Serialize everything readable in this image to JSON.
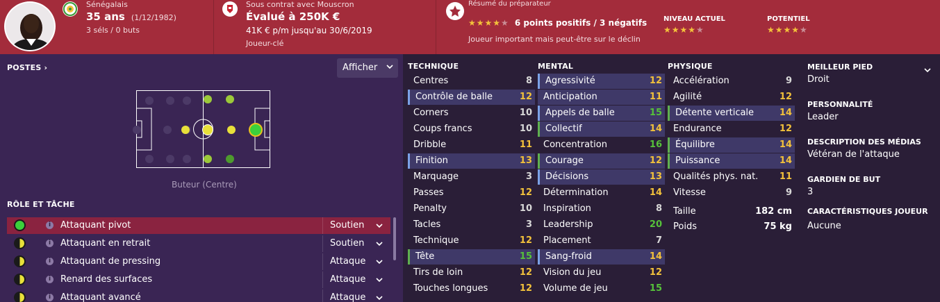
{
  "header": {
    "nationality": "Sénégalais",
    "age": "35 ans",
    "dob": "(1/12/1982)",
    "caps": "3 séls / 0 buts",
    "contract_label": "Sous contrat avec Mouscron",
    "value": "Évalué à 250K €",
    "wage": "41K € p/m jusqu'au 30/6/2019",
    "status": "Joueur-clé",
    "summary_label": "Résumé du préparateur",
    "summary_points": "6 points positifs / 3 négatifs",
    "summary_stars": "★★★★",
    "summary_empty": "★",
    "summary_text": "Joueur important mais peut-être sur le déclin",
    "level_label": "NIVEAU ACTUEL",
    "level_stars": "★★★★",
    "level_empty": "★",
    "potential_label": "POTENTIEL",
    "potential_stars": "★★★★",
    "potential_empty": "★"
  },
  "positions": {
    "title": "POSTES",
    "title_arrow": "›",
    "show_button": "Afficher",
    "caption": "Buteur (Centre)"
  },
  "roles": {
    "title": "RÔLE ET TÂCHE",
    "items": [
      {
        "name": "Attaquant pivot",
        "duty": "Soutien",
        "icon": "full-green"
      },
      {
        "name": "Attaquant en retrait",
        "duty": "Soutien",
        "icon": "half-yellow"
      },
      {
        "name": "Attaquant de pressing",
        "duty": "Attaque",
        "icon": "half-yellow"
      },
      {
        "name": "Renard des surfaces",
        "duty": "Attaque",
        "icon": "half-yellow"
      },
      {
        "name": "Attaquant avancé",
        "duty": "Attaque",
        "icon": "half-yellow"
      }
    ]
  },
  "technique": {
    "title": "TECHNIQUE",
    "items": [
      {
        "label": "Centres",
        "value": "8"
      },
      {
        "label": "Contrôle de balle",
        "value": "12"
      },
      {
        "label": "Corners",
        "value": "10"
      },
      {
        "label": "Coups francs",
        "value": "10"
      },
      {
        "label": "Dribble",
        "value": "11"
      },
      {
        "label": "Finition",
        "value": "13"
      },
      {
        "label": "Marquage",
        "value": "3"
      },
      {
        "label": "Passes",
        "value": "12"
      },
      {
        "label": "Penalty",
        "value": "10"
      },
      {
        "label": "Tacles",
        "value": "3"
      },
      {
        "label": "Technique",
        "value": "12"
      },
      {
        "label": "Tête",
        "value": "15"
      },
      {
        "label": "Tirs de loin",
        "value": "12"
      },
      {
        "label": "Touches longues",
        "value": "12"
      }
    ]
  },
  "mental": {
    "title": "MENTAL",
    "items": [
      {
        "label": "Agressivité",
        "value": "12"
      },
      {
        "label": "Anticipation",
        "value": "11"
      },
      {
        "label": "Appels de balle",
        "value": "15"
      },
      {
        "label": "Collectif",
        "value": "14"
      },
      {
        "label": "Concentration",
        "value": "16"
      },
      {
        "label": "Courage",
        "value": "12"
      },
      {
        "label": "Décisions",
        "value": "13"
      },
      {
        "label": "Détermination",
        "value": "14"
      },
      {
        "label": "Inspiration",
        "value": "8"
      },
      {
        "label": "Leadership",
        "value": "20"
      },
      {
        "label": "Placement",
        "value": "7"
      },
      {
        "label": "Sang-froid",
        "value": "14"
      },
      {
        "label": "Vision du jeu",
        "value": "12"
      },
      {
        "label": "Volume de jeu",
        "value": "15"
      }
    ]
  },
  "physique": {
    "title": "PHYSIQUE",
    "items": [
      {
        "label": "Accélération",
        "value": "9"
      },
      {
        "label": "Agilité",
        "value": "12"
      },
      {
        "label": "Détente verticale",
        "value": "14"
      },
      {
        "label": "Endurance",
        "value": "12"
      },
      {
        "label": "Équilibre",
        "value": "14"
      },
      {
        "label": "Puissance",
        "value": "14"
      },
      {
        "label": "Qualités phys. nat.",
        "value": "11"
      },
      {
        "label": "Vitesse",
        "value": "9"
      }
    ],
    "height_label": "Taille",
    "height_value": "182 cm",
    "weight_label": "Poids",
    "weight_value": "75 kg"
  },
  "info": {
    "foot_label": "MEILLEUR PIED",
    "foot_value": "Droit",
    "personality_label": "PERSONNALITÉ",
    "personality_value": "Leader",
    "media_label": "DESCRIPTION DES MÉDIAS",
    "media_value": "Vétéran de l'attaque",
    "gk_label": "GARDIEN DE BUT",
    "gk_value": "3",
    "traits_label": "CARACTÉRISTIQUES JOUEUR",
    "traits_value": "Aucune"
  },
  "colors": {
    "header": "#a32c3b",
    "panel": "#3a2554",
    "accent_yellow": "#f3c23b",
    "accent_green": "#56c23a"
  }
}
